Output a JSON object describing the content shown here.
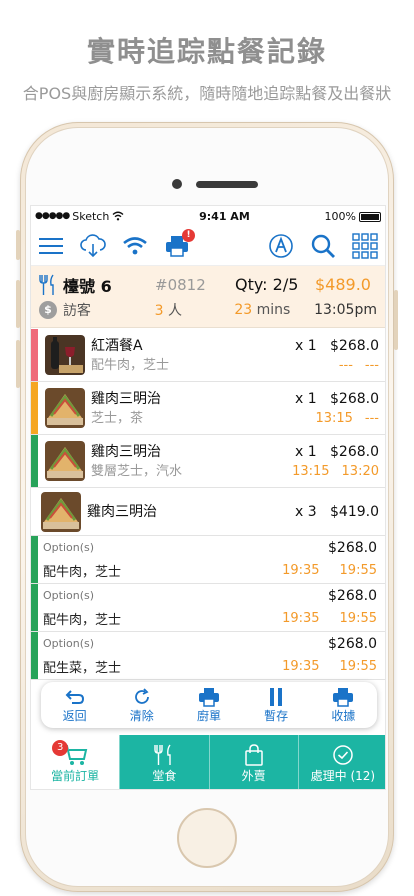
{
  "promo": {
    "headline": "實時追踪點餐記錄",
    "subline": "合POS與廚房顯示系統，隨時隨地追踪點餐及出餐狀"
  },
  "status_bar": {
    "carrier": "Sketch",
    "time": "9:41 AM",
    "battery": "100%"
  },
  "toolbar": {
    "left_icons": [
      "menu-icon",
      "cloud-download-icon",
      "wifi-icon",
      "printer-icon"
    ],
    "printer_badge": "!",
    "right_icons": [
      "font-size-icon",
      "search-icon",
      "grid-icon"
    ]
  },
  "order": {
    "table_label": "檯號 6",
    "order_number": "#0812",
    "qty": "Qty: 2/5",
    "total": "$489.0",
    "guest_type": "訪客",
    "people_count": "3",
    "people_unit": "人",
    "elapsed_value": "23",
    "elapsed_unit": "mins",
    "order_time": "13:05pm"
  },
  "items": [
    {
      "name": "紅酒餐A",
      "desc": "配牛肉，芝士",
      "qty": "x 1",
      "price": "$268.0",
      "time1": "---",
      "time2": "---",
      "bar_color": "#ef6b7b",
      "thumb": "wine"
    },
    {
      "name": "雞肉三明治",
      "desc": "芝士，茶",
      "qty": "x 1",
      "price": "$268.0",
      "time1": "13:15",
      "time2": "---",
      "bar_color": "#f5a623",
      "thumb": "sandwich"
    },
    {
      "name": "雞肉三明治",
      "desc": "雙層芝士，汽水",
      "qty": "x 1",
      "price": "$268.0",
      "time1": "13:15",
      "time2": "13:20",
      "bar_color": "#28a35a",
      "thumb": "sandwich"
    }
  ],
  "combo": {
    "name": "雞肉三明治",
    "qty": "x 3",
    "price": "$419.0"
  },
  "options": [
    {
      "label": "Option(s)",
      "desc": "配牛肉，芝士",
      "price": "$268.0",
      "time1": "19:35",
      "time2": "19:55"
    },
    {
      "label": "Option(s)",
      "desc": "配牛肉，芝士",
      "price": "$268.0",
      "time1": "19:35",
      "time2": "19:55"
    },
    {
      "label": "Option(s)",
      "desc": "配生菜，芝士",
      "price": "$268.0",
      "time1": "19:35",
      "time2": "19:55"
    }
  ],
  "actions": [
    {
      "label": "返回",
      "icon": "back-arrow-icon"
    },
    {
      "label": "清除",
      "icon": "refresh-icon"
    },
    {
      "label": "廚單",
      "icon": "printer-icon"
    },
    {
      "label": "暫存",
      "icon": "pause-icon"
    },
    {
      "label": "收據",
      "icon": "receipt-printer-icon"
    }
  ],
  "tabs": [
    {
      "label": "當前訂單",
      "badge": "3",
      "icon": "cart-icon"
    },
    {
      "label": "堂食",
      "icon": "cutlery-icon"
    },
    {
      "label": "外賣",
      "icon": "shopping-bag-icon"
    },
    {
      "label": "處理中 (12)",
      "icon": "check-circle-icon"
    }
  ],
  "colors": {
    "accent": "#1a73c8",
    "teal": "#1cb5a3",
    "orange": "#f39a2a",
    "header_bg": "#fdf1e3"
  }
}
